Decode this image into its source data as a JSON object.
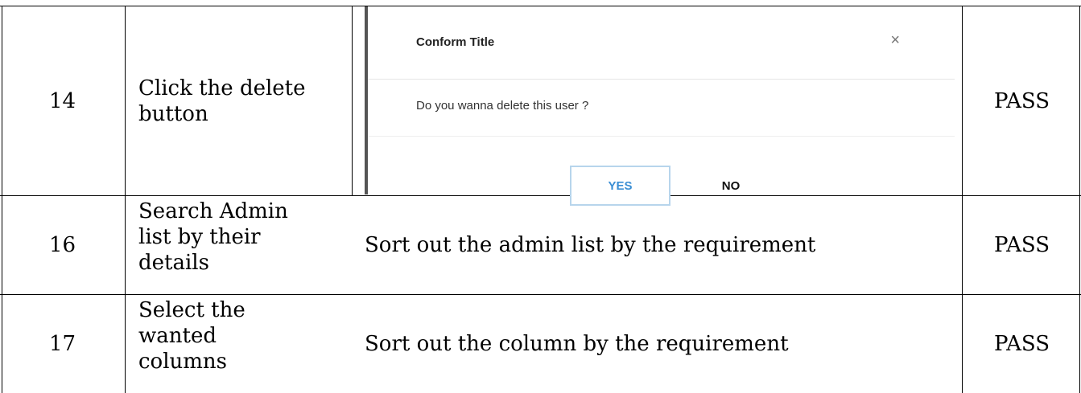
{
  "rows": [
    {
      "number": "14",
      "step": [
        "Click the delete",
        "button"
      ],
      "dialog": {
        "title": "Conform Title",
        "close_icon": "×",
        "message": "Do you wanna delete this user ?",
        "yes_label": "YES",
        "no_label": "NO",
        "accent_color": "#3a8ed4"
      },
      "result": "PASS"
    },
    {
      "number": "16",
      "step": [
        "Search Admin",
        "list by their",
        "details"
      ],
      "description": "Sort out the admin list by the requirement",
      "result": "PASS"
    },
    {
      "number": "17",
      "step": [
        "Select the",
        "wanted",
        "columns"
      ],
      "description": "Sort out the column by the requirement",
      "result": "PASS"
    }
  ]
}
